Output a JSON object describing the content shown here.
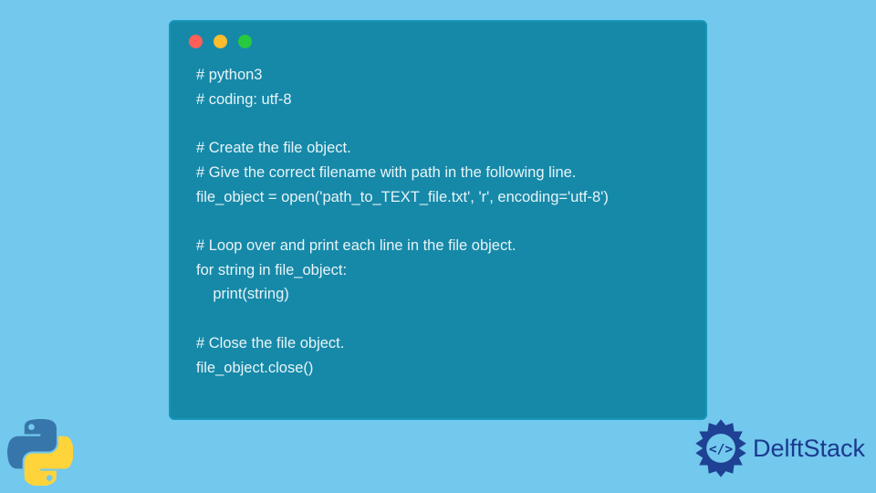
{
  "code": {
    "line1": "# python3",
    "line2": "# coding: utf-8",
    "line3": "# Create the file object.",
    "line4": "# Give the correct filename with path in the following line.",
    "line5": "file_object = open('path_to_TEXT_file.txt', 'r', encoding='utf-8')",
    "line6": "# Loop over and print each line in the file object.",
    "line7": "for string in file_object:",
    "line8": "    print(string)",
    "line9": "# Close the file object.",
    "line10": "file_object.close()"
  },
  "brand": {
    "name": "DelftStack"
  }
}
